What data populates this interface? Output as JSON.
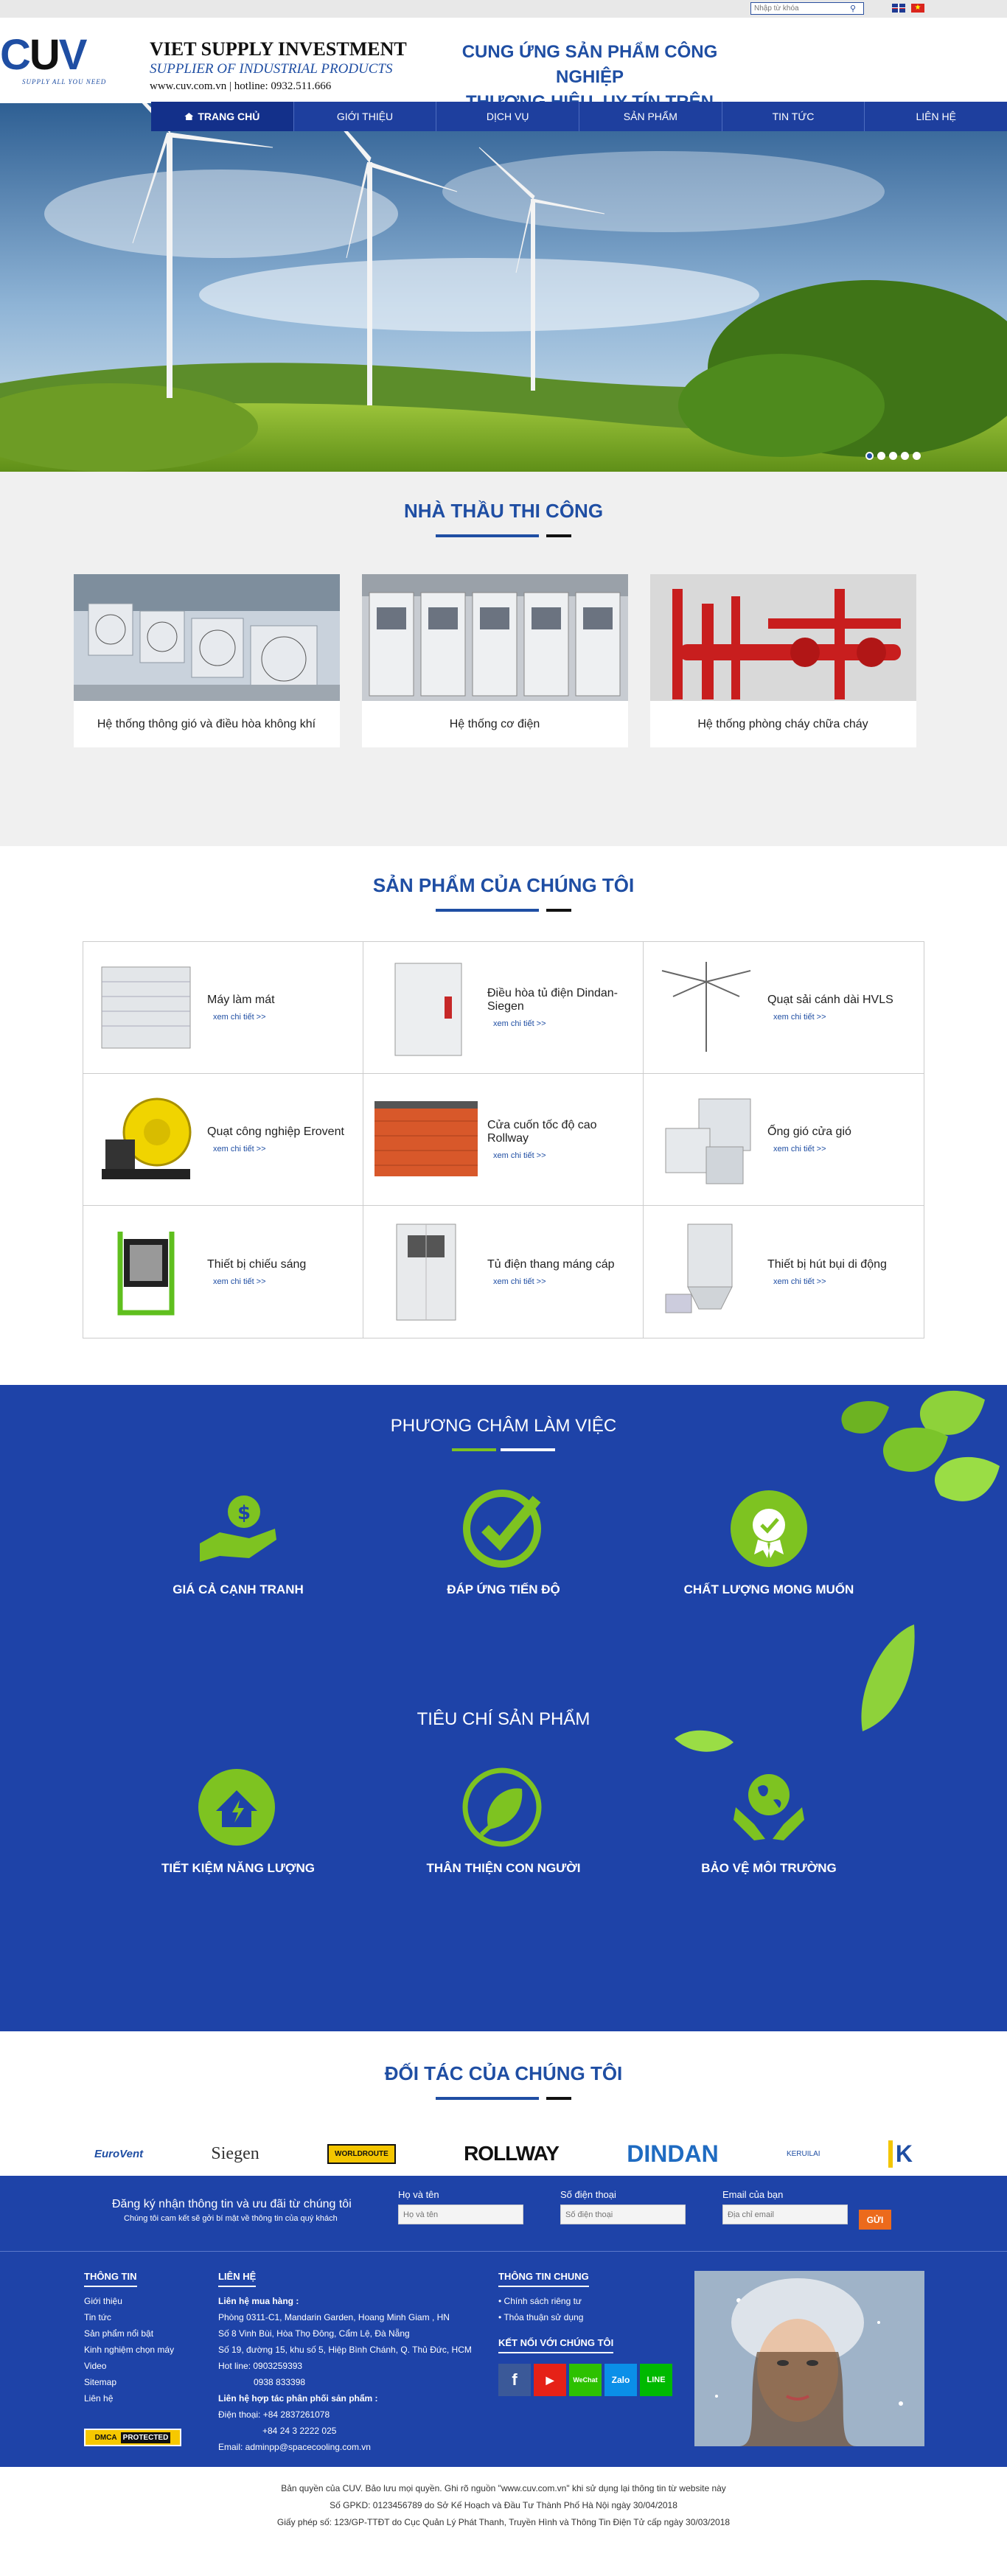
{
  "topbar": {
    "search_placeholder": "Nhập từ khóa"
  },
  "logo": {
    "text_c": "C",
    "text_u": "U",
    "text_v": "V",
    "slogan": "SUPPLY ALL YOU NEED"
  },
  "brand": {
    "name": "VIET SUPPLY INVESTMENT",
    "sub": "SUPPLIER OF INDUSTRIAL PRODUCTS",
    "contact": "www.cuv.com.vn | hotline: 0932.511.666"
  },
  "slogan": {
    "line1": "CUNG ỨNG SẢN PHẨM CÔNG NGHIỆP",
    "line2": "THƯƠNG HIỆU, UY TÍN TRÊN THỊ TRƯỜNG"
  },
  "nav": [
    "TRANG CHỦ",
    "GIỚI THIỆU",
    "DỊCH VỤ",
    "SẢN PHẨM",
    "TIN TỨC",
    "LIÊN HỆ"
  ],
  "contractor": {
    "title": "NHÀ THẦU THI CÔNG",
    "items": [
      "Hệ thống thông gió và điều hòa không khí",
      "Hệ thống cơ điện",
      "Hệ thống phòng cháy chữa cháy"
    ]
  },
  "products": {
    "title": "SẢN PHẨM CỦA CHÚNG TÔI",
    "more": "xem chi tiết >>",
    "items": [
      "Máy làm mát",
      "Điều hòa tủ điện Dindan-Siegen",
      "Quạt sải cánh dài HVLS",
      "Quạt công nghiệp Erovent",
      "Cửa cuốn tốc độ cao Rollway",
      "Ống gió cửa gió",
      "Thiết bị chiếu sáng",
      "Tủ điện thang máng cáp",
      "Thiết bị hút bụi di động"
    ]
  },
  "motto": {
    "title": "PHƯƠNG CHÂM LÀM VIỆC",
    "items": [
      "GIÁ CẢ CẠNH TRANH",
      "ĐÁP ỨNG TIẾN ĐỘ",
      "CHẤT LƯỢNG MONG MUỐN"
    ]
  },
  "criteria": {
    "title": "TIÊU CHÍ SẢN PHẨM",
    "items": [
      "TIẾT KIỆM NĂNG LƯỢNG",
      "THÂN THIỆN CON NGƯỜI",
      "BẢO VỆ MÔI TRƯỜNG"
    ]
  },
  "partners": {
    "title": "ĐỐI TÁC CỦA CHÚNG TÔI",
    "logos": [
      "EuroVent",
      "Siegen",
      "WORLDROUTE",
      "ROLLWAY",
      "DINDAN",
      "KERUILAI",
      "K"
    ]
  },
  "subscribe": {
    "title": "Đăng ký nhận thông tin và ưu đãi từ chúng tôi",
    "subtitle": "Chúng tôi cam kết sẽ gởi bí mật về thông tin của quý khách",
    "name_label": "Họ và tên",
    "name_ph": "Họ và tên",
    "phone_label": "Số điện thoại",
    "phone_ph": "Số điện thoại",
    "email_label": "Email của bạn",
    "email_ph": "Địa chỉ email",
    "button": "GỬI"
  },
  "footer": {
    "info_title": "THÔNG TIN",
    "info_links": [
      "Giới thiệu",
      "Tin tức",
      "Sản phẩm nổi bật",
      "Kinh nghiệm chọn máy",
      "Video",
      "Sitemap",
      "Liên hệ"
    ],
    "contact_title": "LIÊN HỆ",
    "contact_lines": [
      "Liên hệ mua hàng :",
      "Phòng 0311-C1, Mandarin Garden, Hoang Minh Giam , HN",
      "Số 8 Vinh Bùi, Hòa Thọ Đông, Cẩm Lệ, Đà Nẵng",
      "Số 19, đường 15, khu số 5, Hiệp Bình Chánh, Q. Thủ Đức, HCM",
      "Hot line: 0903259393",
      "0938 833398",
      "Liên hệ hợp tác phân phối sản phẩm :",
      "Điện thoại: +84 2837261078",
      "+84 24 3 2222 025",
      "Email: adminpp@spacecooling.com.vn"
    ],
    "general_title": "THÔNG TIN CHUNG",
    "general_links": [
      "Chính sách riêng tư",
      "Thỏa thuận sử dụng"
    ],
    "social_title": "KẾT NỐI VỚI CHÚNG TÔI",
    "social": [
      "f",
      "▶",
      "WeChat",
      "Zalo",
      "LINE"
    ],
    "dmca": "DMCA",
    "dmca2": "PROTECTED"
  },
  "copyright": [
    "Bản quyền của CUV. Bảo lưu mọi quyền. Ghi rõ nguồn \"www.cuv.com.vn\" khi sử dụng lại thông tin từ website này",
    "Số GPKD: 0123456789 do Sở Kế Hoạch và Đầu Tư Thành Phố Hà Nội ngày 30/04/2018",
    "Giấy phép số: 123/GP-TTĐT do Cục Quản Lý Phát Thanh, Truyền Hình và Thông Tin Điện Tử cấp ngày 30/03/2018"
  ],
  "colors": {
    "brand": "#1e43a8",
    "accent": "#7ec321",
    "button": "#ec6a1c"
  }
}
